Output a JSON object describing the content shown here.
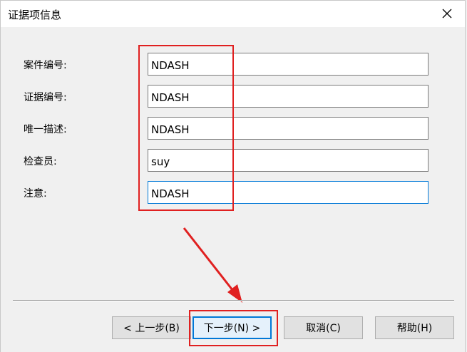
{
  "window": {
    "title": "证据项信息"
  },
  "fields": [
    {
      "label": "案件编号:",
      "value": "NDASH"
    },
    {
      "label": "证据编号:",
      "value": "NDASH"
    },
    {
      "label": "唯一描述:",
      "value": "NDASH"
    },
    {
      "label": "检查员:",
      "value": "suy"
    },
    {
      "label": "注意:",
      "value": "NDASH"
    }
  ],
  "buttons": {
    "back": "< 上一步(B)",
    "next": "下一步(N) >",
    "cancel": "取消(C)",
    "help": "帮助(H)"
  },
  "colors": {
    "annotation": "#e02020",
    "focus_border": "#0078d7"
  },
  "icons": {
    "close": "close-icon"
  }
}
